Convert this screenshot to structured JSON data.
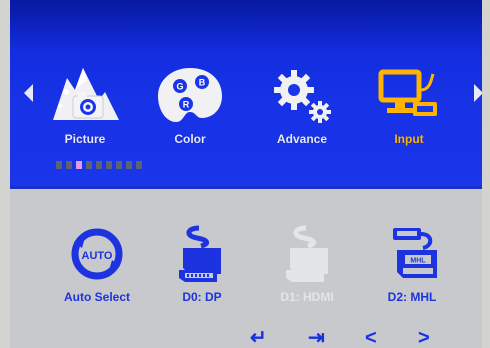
{
  "menu": {
    "items": [
      {
        "label": "Picture",
        "icon": "picture-icon",
        "active": false
      },
      {
        "label": "Color",
        "icon": "color-palette-icon",
        "active": false
      },
      {
        "label": "Advance",
        "icon": "gears-icon",
        "active": false
      },
      {
        "label": "Input",
        "icon": "input-monitor-icon",
        "active": true
      }
    ],
    "page_indicator": {
      "count": 9,
      "active_index": 2
    }
  },
  "input_sources": [
    {
      "label": "Auto Select",
      "icon": "auto-icon",
      "icon_text": "AUTO",
      "enabled": true
    },
    {
      "label": "D0: DP",
      "icon": "displayport-connector-icon",
      "enabled": true
    },
    {
      "label": "D1: HDMI",
      "icon": "hdmi-connector-icon",
      "enabled": false
    },
    {
      "label": "D2: MHL",
      "icon": "mhl-connector-icon",
      "icon_text": "MHL",
      "enabled": true
    }
  ],
  "keys": [
    {
      "icon": "enter-icon",
      "symbol": "↵"
    },
    {
      "icon": "exit-icon",
      "symbol": "⇥"
    },
    {
      "icon": "left-chevron-icon",
      "symbol": "<"
    },
    {
      "icon": "right-chevron-icon",
      "symbol": ">"
    }
  ],
  "colors": {
    "menu_bg": "#1a36ea",
    "active_label": "#ffb400",
    "source_label": "#1e33e0",
    "disabled_label": "#e4e5e8",
    "lower_bg": "#c7c9cc"
  }
}
